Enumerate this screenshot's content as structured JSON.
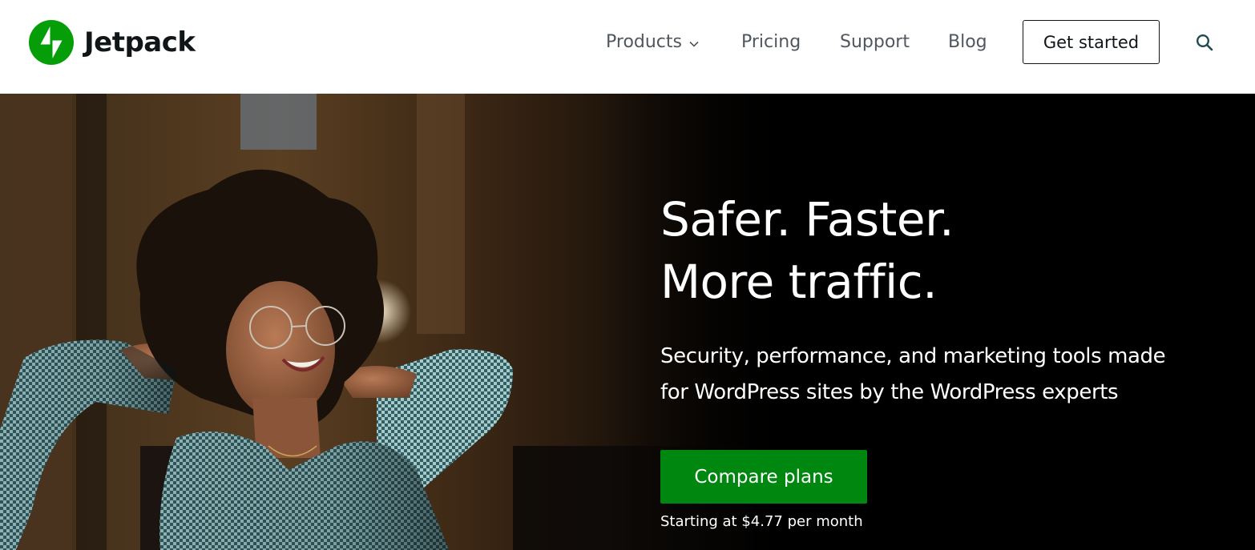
{
  "brand": {
    "name": "Jetpack",
    "accent": "#069e08",
    "text_color": "#101517"
  },
  "nav": {
    "items": [
      {
        "label": "Products",
        "has_dropdown": true,
        "icon": "chevron-down-icon"
      },
      {
        "label": "Pricing"
      },
      {
        "label": "Support"
      },
      {
        "label": "Blog"
      }
    ],
    "cta_label": "Get started",
    "search_icon": "search-icon"
  },
  "hero": {
    "headline_line1": "Safer. Faster.",
    "headline_line2": "More traffic.",
    "subhead_line1": "Security, performance, and marketing tools made",
    "subhead_line2": "for WordPress sites by the WordPress experts",
    "cta_label": "Compare plans",
    "cta_color": "#008710",
    "price_note": "Starting at $4.77 per month",
    "background": "#000000"
  }
}
